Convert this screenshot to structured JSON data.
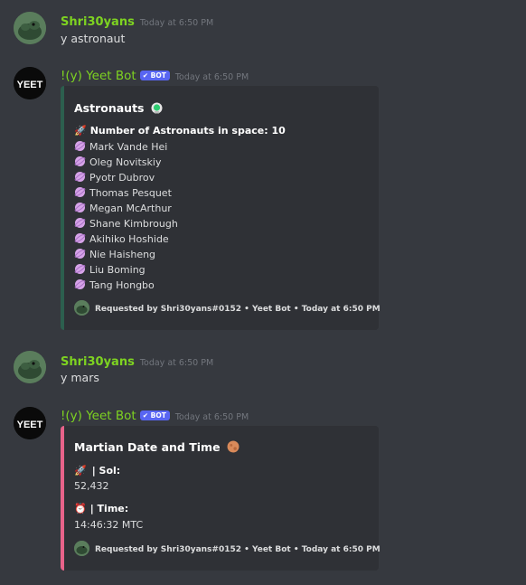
{
  "messages": [
    {
      "author": "Shri30yans",
      "time": "Today at 6:50 PM",
      "text": "y astronaut"
    },
    {
      "author": "!(y) Yeet Bot",
      "badge": "✔ BOT",
      "time": "Today at 6:50 PM",
      "avatar_text": "YEET",
      "embed": {
        "title": "Astronauts",
        "count_label": "Number of Astronauts in space: 10",
        "astronauts": [
          "Mark Vande Hei",
          "Oleg Novitskiy",
          "Pyotr Dubrov",
          "Thomas Pesquet",
          "Megan McArthur",
          "Shane Kimbrough",
          "Akihiko Hoshide",
          "Nie Haisheng",
          "Liu Boming",
          "Tang Hongbo"
        ],
        "footer": "Requested by Shri30yans#0152 • Yeet Bot • Today at 6:50 PM",
        "accent": "#2c5f4e"
      }
    },
    {
      "author": "Shri30yans",
      "time": "Today at 6:50 PM",
      "text": "y mars"
    },
    {
      "author": "!(y) Yeet Bot",
      "badge": "✔ BOT",
      "time": "Today at 6:50 PM",
      "avatar_text": "YEET",
      "embed": {
        "title": "Martian Date and Time",
        "sol_label": "| Sol:",
        "sol_value": "52,432",
        "time_label": "| Time:",
        "time_value": "14:46:32 MTC",
        "footer": "Requested by Shri30yans#0152 • Yeet Bot • Today at 6:50 PM",
        "accent": "#e8638a"
      }
    }
  ],
  "colors": {
    "background": "#36393f",
    "embed_bg": "#2f3136",
    "username": "#7ed321",
    "bot_tag": "#5865f2"
  }
}
